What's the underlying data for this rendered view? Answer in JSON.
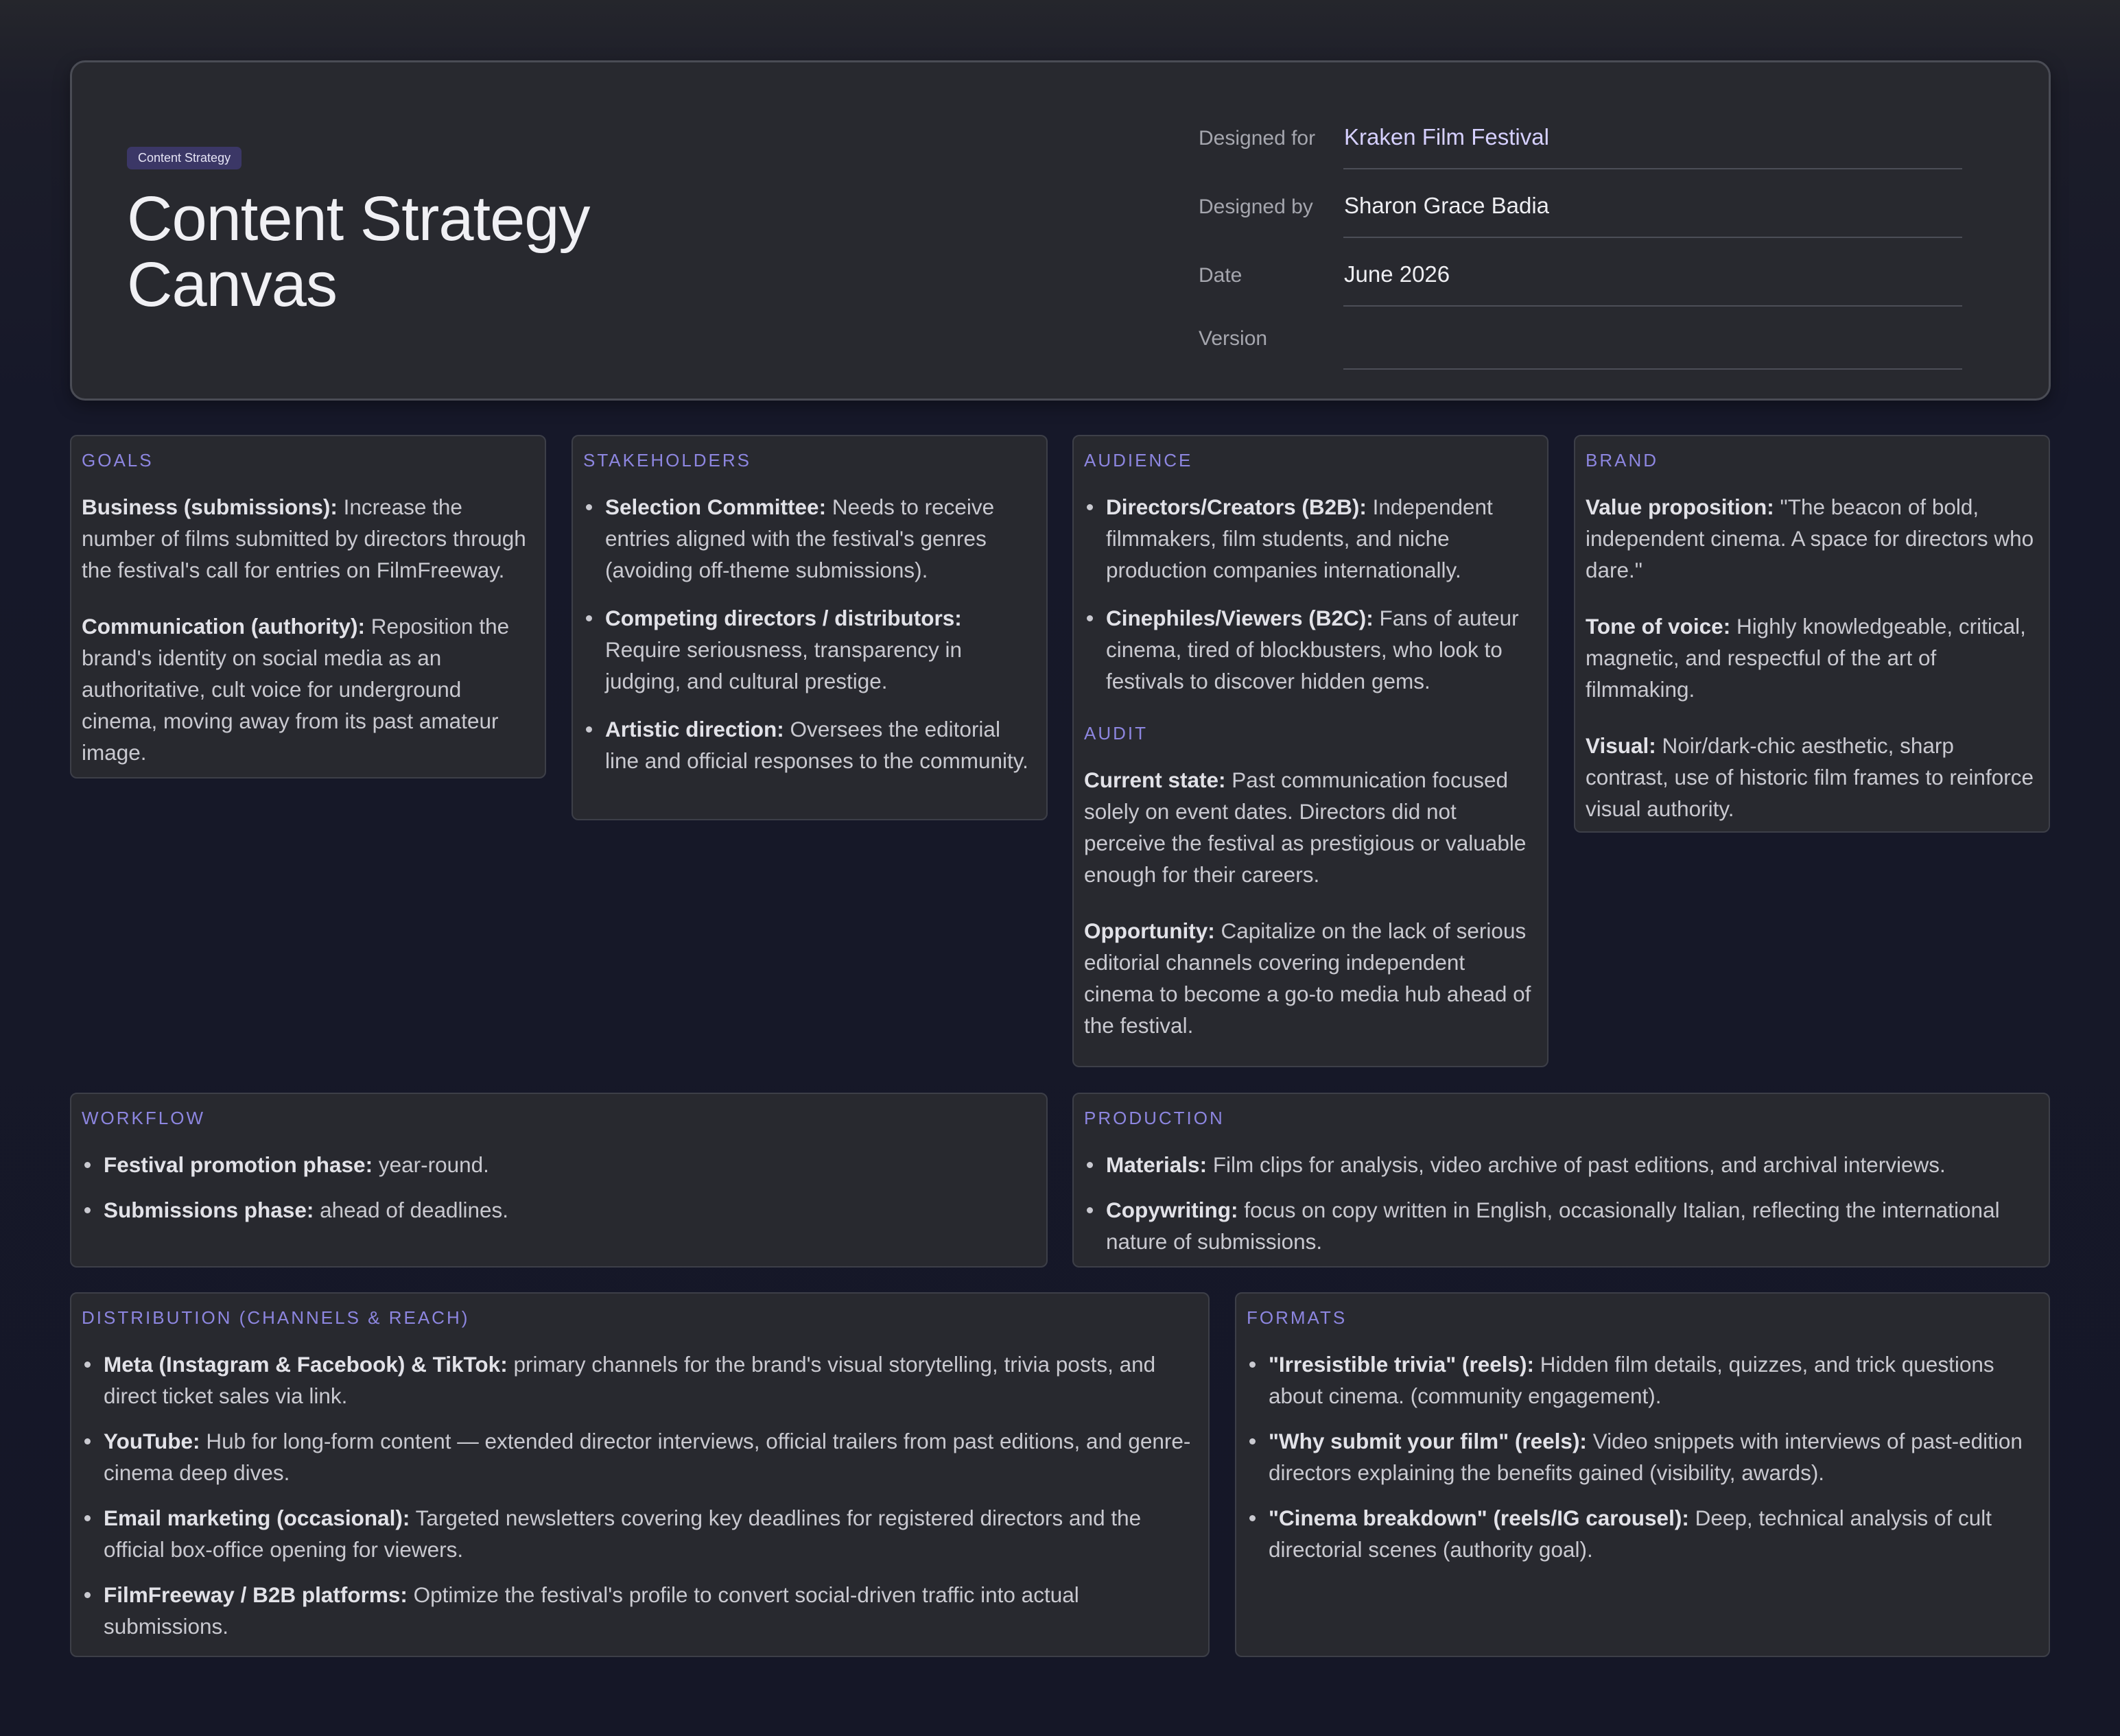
{
  "header": {
    "badge": "Content Strategy",
    "title": "Content Strategy Canvas",
    "meta": [
      {
        "label": "Designed for",
        "value": "Kraken Film Festival"
      },
      {
        "label": "Designed by",
        "value": "Sharon Grace Badia"
      },
      {
        "label": "Date",
        "value": "June 2026"
      },
      {
        "label": "Version",
        "value": ""
      }
    ]
  },
  "goals": {
    "title": "GOALS",
    "items": [
      {
        "bold": "Business (submissions):",
        "text": " Increase the number of films submitted by directors through the festival's call for entries on FilmFreeway."
      },
      {
        "bold": "Communication (authority):",
        "text": " Reposition the brand's identity on social media as an authoritative, cult voice for underground cinema, moving away from its past amateur image."
      }
    ]
  },
  "stakeholders": {
    "title": "STAKEHOLDERS",
    "items": [
      {
        "bold": "Selection Committee:",
        "text": " Needs to receive entries aligned with the festival's genres (avoiding off-theme submissions)."
      },
      {
        "bold": "Competing directors / distributors:",
        "text": " Require seriousness, transparency in judging, and cultural prestige."
      },
      {
        "bold": "Artistic direction:",
        "text": " Oversees the editorial line and official responses to the community."
      }
    ]
  },
  "audience": {
    "title": "AUDIENCE",
    "items": [
      {
        "bold": "Directors/Creators (B2B):",
        "text": " Independent filmmakers, film students, and niche production companies internationally."
      },
      {
        "bold": "Cinephiles/Viewers (B2C):",
        "text": " Fans of auteur cinema, tired of blockbusters, who look to festivals to discover hidden gems."
      }
    ]
  },
  "audit": {
    "title": "AUDIT",
    "items": [
      {
        "bold": "Current state:",
        "text": " Past communication focused solely on event dates. Directors did not perceive the festival as prestigious or valuable enough for their careers."
      },
      {
        "bold": "Opportunity:",
        "text": " Capitalize on the lack of serious editorial channels covering independent cinema to become a go-to media hub ahead of the festival."
      }
    ]
  },
  "brand": {
    "title": "BRAND",
    "items": [
      {
        "bold": "Value proposition:",
        "text": " \"The beacon of bold, independent cinema. A space for directors who dare.\""
      },
      {
        "bold": "Tone of voice:",
        "text": " Highly knowledgeable, critical, magnetic, and respectful of the art of filmmaking."
      },
      {
        "bold": "Visual:",
        "text": " Noir/dark-chic aesthetic, sharp contrast, use of historic film frames to reinforce visual authority."
      }
    ]
  },
  "workflow": {
    "title": "WORKFLOW",
    "items": [
      {
        "bold": "Festival promotion phase:",
        "text": " year-round."
      },
      {
        "bold": "Submissions phase:",
        "text": " ahead of deadlines."
      }
    ]
  },
  "production": {
    "title": "PRODUCTION",
    "items": [
      {
        "bold": "Materials:",
        "text": " Film clips for analysis, video archive of past editions, and archival interviews."
      },
      {
        "bold": "Copywriting:",
        "text": " focus on copy written in English, occasionally Italian, reflecting the international nature of submissions."
      }
    ]
  },
  "distribution": {
    "title": "DISTRIBUTION (CHANNELS & REACH)",
    "items": [
      {
        "bold": "Meta (Instagram & Facebook) & TikTok:",
        "text": " primary channels for the brand's visual storytelling, trivia posts, and direct ticket sales via link."
      },
      {
        "bold": "YouTube:",
        "text": " Hub for long-form content — extended director interviews, official trailers from past editions, and genre-cinema deep dives."
      },
      {
        "bold": "Email marketing (occasional):",
        "text": " Targeted newsletters covering key deadlines for registered directors and the official box-office opening for viewers."
      },
      {
        "bold": "FilmFreeway / B2B platforms:",
        "text": " Optimize the festival's profile to convert social-driven traffic into actual submissions."
      }
    ]
  },
  "formats": {
    "title": "FORMATS",
    "items": [
      {
        "bold": "\"Irresistible trivia\" (reels):",
        "text": " Hidden film details, quizzes, and trick questions about cinema. (community engagement)."
      },
      {
        "bold": "\"Why submit your film\" (reels):",
        "text": " Video snippets with interviews of past-edition directors explaining the benefits gained (visibility, awards)."
      },
      {
        "bold": "\"Cinema breakdown\" (reels/IG carousel):",
        "text": " Deep, technical analysis of cult directorial scenes (authority goal)."
      }
    ]
  }
}
